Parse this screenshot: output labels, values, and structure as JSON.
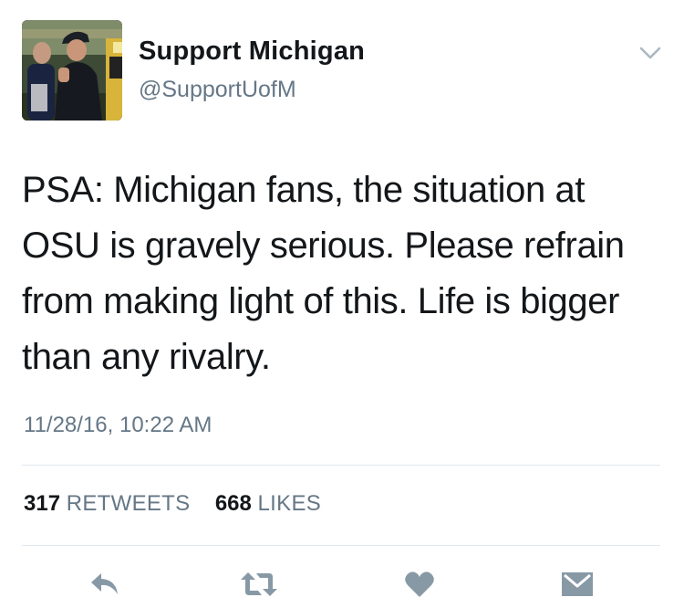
{
  "author": {
    "display_name": "Support Michigan",
    "handle": "@SupportUofM"
  },
  "tweet": {
    "text_lines": [
      "PSA: Michigan fans, the situation at",
      "OSU is gravely serious. Please refrain",
      "from making light of this. Life is bigger",
      "than any rivalry."
    ],
    "timestamp": "11/28/16, 10:22 AM"
  },
  "stats": {
    "retweets_count": "317",
    "retweets_label": "RETWEETS",
    "likes_count": "668",
    "likes_label": "LIKES"
  },
  "actions": [
    {
      "name": "reply",
      "icon": "reply-icon"
    },
    {
      "name": "retweet",
      "icon": "retweet-icon"
    },
    {
      "name": "like",
      "icon": "heart-icon"
    },
    {
      "name": "direct-message",
      "icon": "envelope-icon"
    }
  ],
  "colors": {
    "text": "#14171a",
    "secondary": "#657786",
    "icon": "#8899a6",
    "divider": "#e1e8ed"
  }
}
